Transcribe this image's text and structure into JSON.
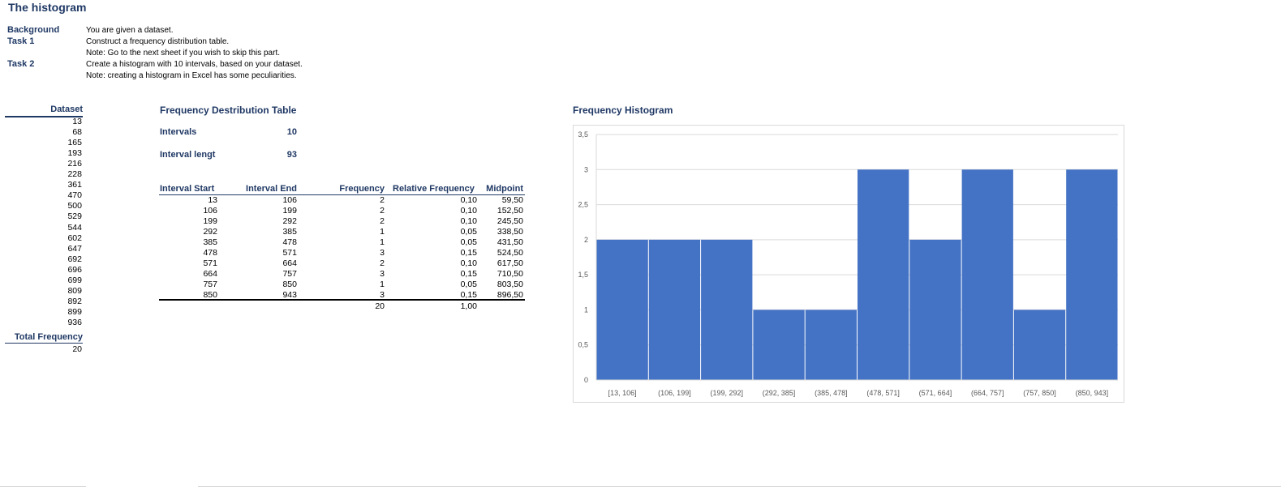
{
  "title": "The histogram",
  "instructions": {
    "background_label": "Background",
    "background_text": "You are given a dataset.",
    "task1_label": "Task 1",
    "task1_text": "Construct a frequency distribution table.",
    "task1_note": "Note: Go to the next sheet if you wish to skip this part.",
    "task2_label": "Task 2",
    "task2_text": "Create a histogram with 10 intervals, based on your dataset.",
    "task2_note": "Note: creating a histogram in Excel has some peculiarities."
  },
  "dataset": {
    "header": "Dataset",
    "values": [
      "13",
      "68",
      "165",
      "193",
      "216",
      "228",
      "361",
      "470",
      "500",
      "529",
      "544",
      "602",
      "647",
      "692",
      "696",
      "699",
      "809",
      "892",
      "899",
      "936"
    ],
    "total_label": "Total Frequency",
    "total_value": "20"
  },
  "freq_table": {
    "title": "Frequency Destribution Table",
    "intervals_label": "Intervals",
    "intervals_value": "10",
    "length_label": "Interval lengt",
    "length_value": "93",
    "headers": [
      "Interval Start",
      "Interval End",
      "Frequency",
      "Relative Frequency",
      "Midpoint"
    ],
    "rows": [
      [
        "13",
        "106",
        "2",
        "0,10",
        "59,50"
      ],
      [
        "106",
        "199",
        "2",
        "0,10",
        "152,50"
      ],
      [
        "199",
        "292",
        "2",
        "0,10",
        "245,50"
      ],
      [
        "292",
        "385",
        "1",
        "0,05",
        "338,50"
      ],
      [
        "385",
        "478",
        "1",
        "0,05",
        "431,50"
      ],
      [
        "478",
        "571",
        "3",
        "0,15",
        "524,50"
      ],
      [
        "571",
        "664",
        "2",
        "0,10",
        "617,50"
      ],
      [
        "664",
        "757",
        "3",
        "0,15",
        "710,50"
      ],
      [
        "757",
        "850",
        "1",
        "0,05",
        "803,50"
      ],
      [
        "850",
        "943",
        "3",
        "0,15",
        "896,50"
      ]
    ],
    "total_frequency": "20",
    "total_relative": "1,00"
  },
  "chart_title": "Frequency Histogram",
  "chart_data": {
    "type": "bar",
    "categories": [
      "[13, 106]",
      "(106, 199]",
      "(199, 292]",
      "(292, 385]",
      "(385, 478]",
      "(478, 571]",
      "(571, 664]",
      "(664, 757]",
      "(757, 850]",
      "(850, 943]"
    ],
    "values": [
      2,
      2,
      2,
      1,
      1,
      3,
      2,
      3,
      1,
      3
    ],
    "ylim": [
      0,
      3.5
    ],
    "yticks": [
      "0",
      "0,5",
      "1",
      "1,5",
      "2",
      "2,5",
      "3",
      "3,5"
    ],
    "bar_color": "#4472c4",
    "grid": true
  }
}
